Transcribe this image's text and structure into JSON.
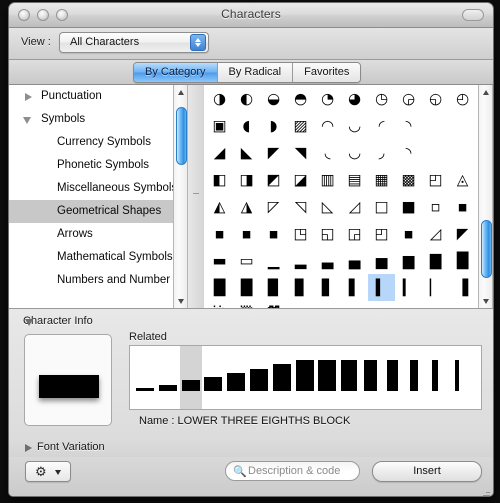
{
  "window": {
    "title": "Characters",
    "traffic_lights": [
      "close-button",
      "minimize-button",
      "zoom-button"
    ],
    "toolbar_toggle": "toolbar-toggle-button"
  },
  "view_bar": {
    "label": "View :",
    "selected": "All Characters"
  },
  "tabs": [
    {
      "label": "By Category",
      "active": true
    },
    {
      "label": "By Radical",
      "active": false
    },
    {
      "label": "Favorites",
      "active": false
    }
  ],
  "sidebar": {
    "items": [
      {
        "label": "Punctuation",
        "level": "top",
        "disclosure": "closed",
        "selected": false
      },
      {
        "label": "Symbols",
        "level": "top",
        "disclosure": "open",
        "selected": false
      },
      {
        "label": "Currency Symbols",
        "level": "sub",
        "disclosure": "none",
        "selected": false
      },
      {
        "label": "Phonetic Symbols",
        "level": "sub",
        "disclosure": "none",
        "selected": false
      },
      {
        "label": "Miscellaneous Symbols",
        "level": "sub",
        "disclosure": "none",
        "selected": false
      },
      {
        "label": "Geometrical Shapes",
        "level": "sub",
        "disclosure": "none",
        "selected": true
      },
      {
        "label": "Arrows",
        "level": "sub",
        "disclosure": "none",
        "selected": false
      },
      {
        "label": "Mathematical Symbols",
        "level": "sub",
        "disclosure": "none",
        "selected": false
      },
      {
        "label": "Numbers and Number Syr",
        "level": "sub",
        "disclosure": "none",
        "selected": false
      }
    ],
    "scrollbar": {
      "thumb_top_pct": 4,
      "thumb_height_pct": 30
    }
  },
  "grid": {
    "selected_index": 72,
    "scrollbar": {
      "thumb_top_pct": 62,
      "thumb_height_pct": 30
    },
    "rows": [
      [
        "◑",
        "◐",
        "◒",
        "◓",
        "◔",
        "◕",
        "◷",
        "◶",
        "◵",
        "◴"
      ],
      [
        "▣",
        "◖",
        "◗",
        "▨",
        "◠",
        "◡",
        "◜",
        "◝"
      ],
      [
        "◢",
        "◣",
        "◤",
        "◥",
        "◟",
        "◡",
        "◞",
        "◝"
      ],
      [
        "◧",
        "◨",
        "◩",
        "◪",
        "▥",
        "▤",
        "▦",
        "▩",
        "◰",
        "◬"
      ],
      [
        "◭",
        "◮",
        "◸",
        "◹",
        "◺",
        "◿",
        "□",
        "■",
        "▫",
        "▪"
      ],
      [
        "▪",
        "▪",
        "▪",
        "◳",
        "◱",
        "◲",
        "◰",
        "▪",
        "◿",
        "◤"
      ],
      [
        "▬",
        "▭",
        "▁",
        "▂",
        "▃",
        "▄",
        "▅",
        "▆",
        "▇",
        "█"
      ],
      [
        "█",
        "█",
        "▉",
        "▊",
        "▋",
        "▌",
        "▍",
        "▎",
        "▏",
        "▐"
      ],
      [
        "░",
        "▒",
        "▓"
      ]
    ]
  },
  "character_info": {
    "header": "Character Info",
    "related_label": "Related",
    "name_label": "Name :",
    "name_value": "LOWER THREE EIGHTHS BLOCK",
    "related_highlight_index": 2,
    "related_heights": [
      3,
      6,
      11,
      14,
      18,
      22,
      27,
      31,
      31,
      28,
      25,
      21,
      17,
      13,
      9
    ]
  },
  "font_variation": {
    "label": "Font Variation",
    "disclosure": "closed"
  },
  "bottom_bar": {
    "gear_button": "⚙",
    "search_placeholder": "Description & code",
    "search_value": "",
    "insert_label": "Insert"
  },
  "colors": {
    "selection_blue": "#b6d7fa",
    "sidebar_selection": "#c8c8c8",
    "tab_active": "#4e9bec",
    "scrollbar_thumb": "#2f8fe4"
  }
}
